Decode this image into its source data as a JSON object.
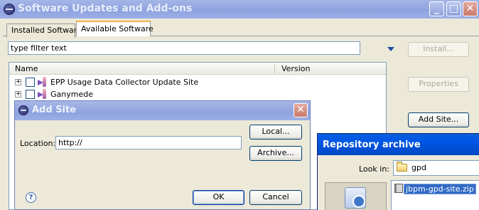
{
  "main_window": {
    "title": "Software Updates and Add-ons",
    "caption_buttons": {
      "minimize": "_",
      "maximize": "□",
      "close": "✕"
    },
    "tabs": [
      {
        "label": "Installed Software",
        "selected": false
      },
      {
        "label": "Available Software",
        "selected": true
      }
    ],
    "filter": {
      "placeholder": "type filter text",
      "value": "type filter text"
    },
    "table": {
      "columns": [
        "Name",
        "Version"
      ],
      "rows": [
        {
          "label": "EPP Usage Data Collector Update Site",
          "version": "",
          "checked": false,
          "expander": "+"
        },
        {
          "label": "Ganymede",
          "version": "",
          "checked": false,
          "expander": "+"
        }
      ]
    },
    "buttons": {
      "install": "Install...",
      "properties": "Properties",
      "add_site": "Add Site..."
    }
  },
  "add_site_dialog": {
    "title": "Add Site",
    "close": "✕",
    "location_label": "Location:",
    "location_value": "http://",
    "buttons": {
      "local": "Local...",
      "archive": "Archive...",
      "ok": "OK",
      "cancel": "Cancel"
    },
    "help_icon": "?"
  },
  "repository_archive_dialog": {
    "title": "Repository archive",
    "look_in_label": "Look in:",
    "look_in_value": "gpd",
    "files": [
      {
        "name": "jbpm-gpd-site.zip",
        "selected": true
      }
    ]
  },
  "colors": {
    "window_bg": "#ece9d8",
    "active_title": "#0058e6",
    "inactive_title": "#8ea2df",
    "tab_highlight": "#f2b24a",
    "selection": "#316ac5"
  }
}
